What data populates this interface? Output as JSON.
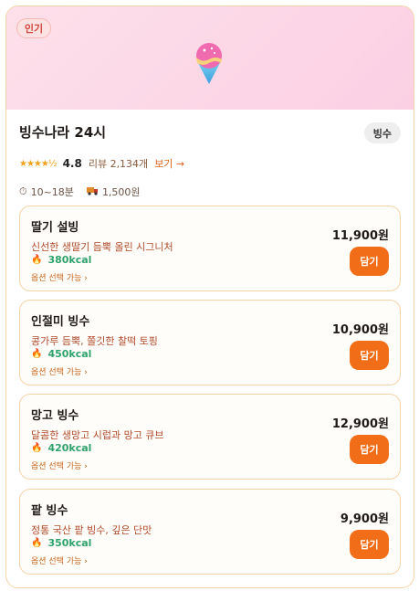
{
  "store": {
    "badge": "인기",
    "name": "빙수나라 24시",
    "category": "빙수",
    "stars": "★★★★½",
    "rating": "4.8",
    "reviews": "리뷰 2,134개",
    "view_link": "보기 →",
    "delivery_time": "10~18분",
    "delivery_fee": "1,500원",
    "icons": {
      "hero": "shaved-ice-icon",
      "clock": "clock-icon",
      "truck": "truck-icon",
      "flame": "flame-icon"
    }
  },
  "menu": [
    {
      "name": "딸기 설빙",
      "desc": "신선한 생딸기 듬뿍 올린 시그니처",
      "kcal": "380kcal",
      "option": "옵션 선택 가능 ›",
      "price": "11,900원",
      "button": "담기"
    },
    {
      "name": "인절미 빙수",
      "desc": "콩가루 듬뿍, 쫄깃한 찰떡 토핑",
      "kcal": "450kcal",
      "option": "옵션 선택 가능 ›",
      "price": "10,900원",
      "button": "담기"
    },
    {
      "name": "망고 빙수",
      "desc": "달콤한 생망고 시럽과 망고 큐브",
      "kcal": "420kcal",
      "option": "옵션 선택 가능 ›",
      "price": "12,900원",
      "button": "담기"
    },
    {
      "name": "팥 빙수",
      "desc": "정통 국산 팥 빙수, 깊은 단맛",
      "kcal": "350kcal",
      "option": "옵션 선택 가능 ›",
      "price": "9,900원",
      "button": "담기"
    }
  ],
  "colors": {
    "accent": "#f26d18",
    "kcal": "#2fa36b",
    "hero_bg": "#fbd0e4"
  }
}
